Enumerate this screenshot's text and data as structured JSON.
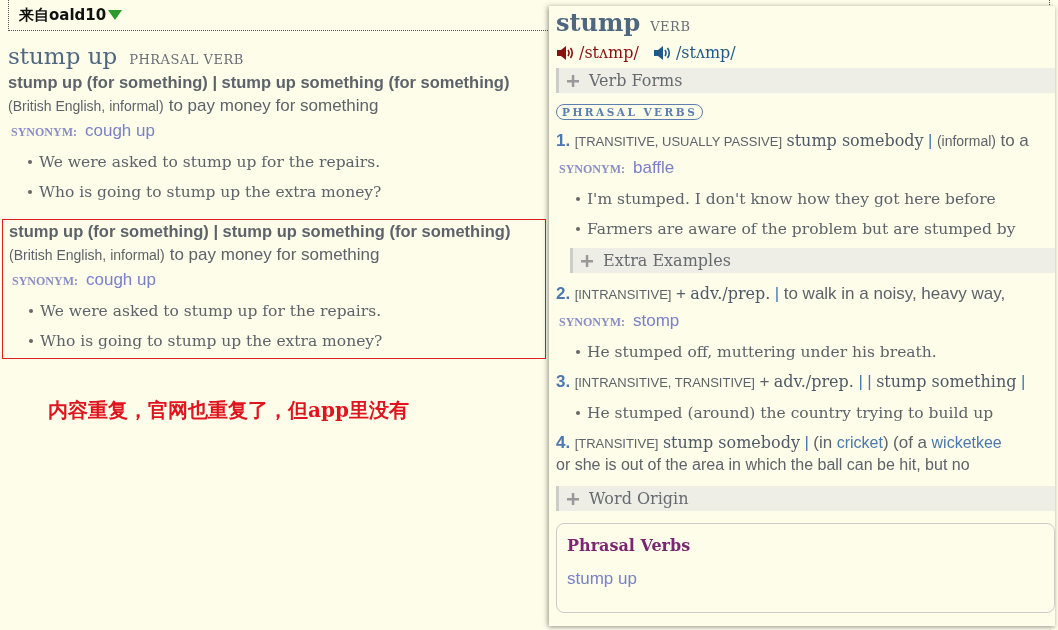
{
  "header": {
    "source": "来自oald10"
  },
  "entry": {
    "headword": "stump up",
    "pos": "PHRASAL VERB",
    "senses": [
      {
        "highlighted": false,
        "pattern": "stump up (for something) | stump up something (for something)",
        "label": "(British English, informal)",
        "definition": "to pay money for something",
        "synonym_label": "SYNONYM:",
        "synonym": "cough up",
        "examples": [
          "We were asked to stump up for the repairs.",
          "Who is going to stump up the extra money?"
        ]
      },
      {
        "highlighted": true,
        "pattern": "stump up (for something) | stump up something (for something)",
        "label": "(British English, informal)",
        "definition": "to pay money for something",
        "synonym_label": "SYNONYM:",
        "synonym": "cough up",
        "examples": [
          "We were asked to stump up for the repairs.",
          "Who is going to stump up the extra money?"
        ]
      }
    ]
  },
  "note": "内容重复，官网也重复了，但app里没有",
  "popup": {
    "headword": "stump",
    "pos": "VERB",
    "pronunciations": [
      {
        "text": "/stʌmp/",
        "color": "#8b1010"
      },
      {
        "text": "/stʌmp/",
        "color": "#1f5a8c"
      }
    ],
    "verb_forms": {
      "label": "Verb Forms",
      "expanded": false
    },
    "badge": "PHRASAL VERBS",
    "senses": [
      {
        "number": "1.",
        "parts": [
          {
            "kind": "grammar",
            "text": "[TRANSITIVE, USUALLY PASSIVE]"
          },
          {
            "kind": "pattern",
            "text": "stump somebody"
          },
          {
            "kind": "sep",
            "text": "|"
          },
          {
            "kind": "label",
            "text": "(informal)"
          },
          {
            "kind": "def",
            "text": "to a"
          }
        ],
        "synonym_label": "SYNONYM:",
        "synonym": "baffle",
        "examples": [
          "I'm stumped. I don't know how they got here before",
          "Farmers are aware of the problem but are stumped by"
        ],
        "extra": {
          "label": "Extra Examples",
          "expanded": false
        }
      },
      {
        "number": "2.",
        "parts": [
          {
            "kind": "grammar",
            "text": "[INTRANSITIVE]"
          },
          {
            "kind": "def",
            "text": "+"
          },
          {
            "kind": "pattern",
            "text": "adv./prep."
          },
          {
            "kind": "sep",
            "text": "|"
          },
          {
            "kind": "def",
            "text": "to walk in a noisy, heavy way,"
          }
        ],
        "synonym_label": "SYNONYM:",
        "synonym": "stomp",
        "examples": [
          "He stumped off, muttering under his breath."
        ]
      },
      {
        "number": "3.",
        "parts": [
          {
            "kind": "grammar",
            "text": "[INTRANSITIVE, TRANSITIVE]"
          },
          {
            "kind": "def",
            "text": "+"
          },
          {
            "kind": "pattern",
            "text": "adv./prep."
          },
          {
            "kind": "sep",
            "text": "|"
          },
          {
            "kind": "sep",
            "text": "|"
          },
          {
            "kind": "pattern",
            "text": "stump something"
          },
          {
            "kind": "sep",
            "text": "|"
          }
        ],
        "examples": [
          "He stumped (around) the country trying to build up"
        ]
      },
      {
        "number": "4.",
        "parts": [
          {
            "kind": "grammar",
            "text": "[TRANSITIVE]"
          },
          {
            "kind": "pattern",
            "text": "stump somebody"
          },
          {
            "kind": "sep",
            "text": "|"
          },
          {
            "kind": "def",
            "text": "(in"
          },
          {
            "kind": "link",
            "text": "cricket"
          },
          {
            "kind": "def",
            "text": ")",
            "tight": true
          },
          {
            "kind": "def",
            "text": "(of a"
          },
          {
            "kind": "link",
            "text": "wicketkee"
          }
        ],
        "continuation": "or she is out of the area in which the ball can be hit, but no"
      }
    ],
    "word_origin": {
      "label": "Word Origin",
      "expanded": false
    },
    "phrasal_verbs": {
      "title": "Phrasal Verbs",
      "links": [
        "stump up"
      ]
    }
  }
}
